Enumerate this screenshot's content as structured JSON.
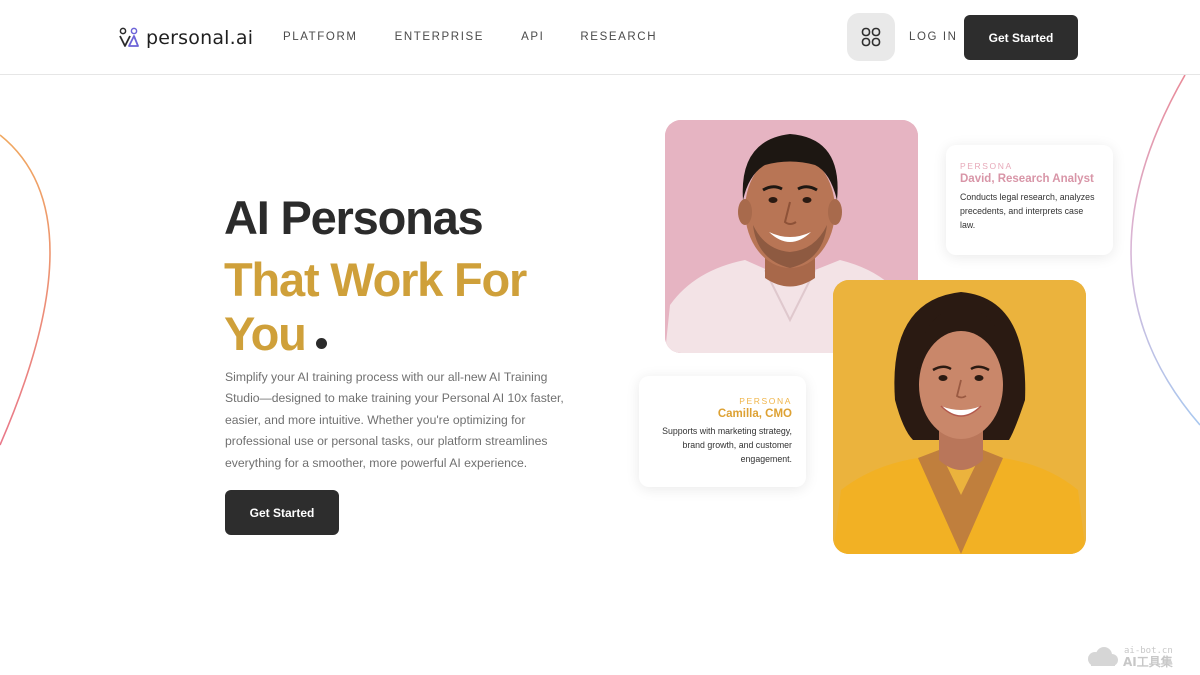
{
  "header": {
    "logo_text": "personal.ai",
    "nav": [
      {
        "label": "PLATFORM"
      },
      {
        "label": "ENTERPRISE"
      },
      {
        "label": "API"
      },
      {
        "label": "RESEARCH"
      }
    ],
    "apps_icon": "grid-icon",
    "login_label": "LOG IN",
    "cta_label": "Get Started"
  },
  "hero": {
    "title_line1": "AI Personas",
    "title_line2": "That Work For",
    "title_line3": "You",
    "description": "Simplify your AI training process with our all-new AI Training Studio—designed to make training your Personal AI 10x faster, easier, and more intuitive. Whether you're optimizing for professional use or personal tasks, our platform streamlines everything for a smoother, more powerful AI experience.",
    "cta_label": "Get Started"
  },
  "personas": [
    {
      "tag": "PERSONA",
      "name": "David, Research Analyst",
      "description": "Conducts legal research, analyzes precedents, and interprets case law."
    },
    {
      "tag": "PERSONA",
      "name": "Camilla, CMO",
      "description": "Supports with marketing strategy, brand growth, and customer engagement."
    }
  ],
  "watermark": {
    "domain": "ai-bot.cn",
    "brand": "AI工具集"
  },
  "colors": {
    "accent_gold": "#cfa03a",
    "dark_button": "#2d2d2d",
    "david_bg": "#e6b4c2",
    "camilla_bg": "#ebb33d"
  }
}
